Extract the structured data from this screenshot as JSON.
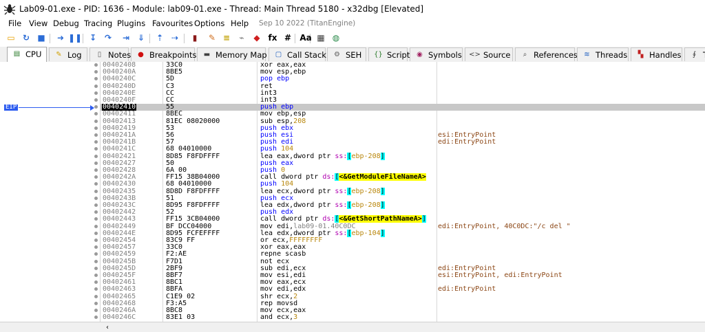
{
  "window": {
    "title": "Lab09-01.exe - PID: 1636 - Module: lab09-01.exe - Thread: Main Thread 5180 - x32dbg [Elevated]"
  },
  "menu": {
    "items": [
      "File",
      "View",
      "Debug",
      "Tracing",
      "Plugins",
      "Favourites",
      "Options",
      "Help"
    ],
    "build": "Sep 10 2022 (TitanEngine)"
  },
  "toolbar": {
    "buttons": [
      {
        "name": "open-icon",
        "glyph": "▭",
        "color": "#e8a000"
      },
      {
        "name": "restart-icon",
        "glyph": "↻",
        "color": "#2b6cd6"
      },
      {
        "name": "stop-icon",
        "glyph": "■",
        "color": "#2b6cd6"
      },
      {
        "name": "run-icon",
        "glyph": "➜",
        "color": "#2b6cd6"
      },
      {
        "name": "pause-icon",
        "glyph": "❚❚",
        "color": "#2b6cd6"
      },
      {
        "name": "step-into-icon",
        "glyph": "↧",
        "color": "#2b6cd6"
      },
      {
        "name": "step-over-icon",
        "glyph": "↷",
        "color": "#2b6cd6"
      },
      {
        "name": "trace-into-icon",
        "glyph": "⇥",
        "color": "#2b6cd6"
      },
      {
        "name": "trace-over-icon",
        "glyph": "⇓",
        "color": "#2b6cd6"
      },
      {
        "name": "execute-till-return-icon",
        "glyph": "⇡",
        "color": "#2b6cd6"
      },
      {
        "name": "run-to-user-code-icon",
        "glyph": "⇢",
        "color": "#2b6cd6"
      },
      {
        "name": "scylla-icon",
        "glyph": "▮",
        "color": "#8b1a1a"
      },
      {
        "name": "patch-icon",
        "glyph": "✎",
        "color": "#d07020"
      },
      {
        "name": "comment-icon",
        "glyph": "≡",
        "color": "#c0a000"
      },
      {
        "name": "label-icon",
        "glyph": "⌁",
        "color": "#7a7a7a"
      },
      {
        "name": "bookmark-icon",
        "glyph": "◆",
        "color": "#d02020"
      },
      {
        "name": "function-icon",
        "glyph": "fx",
        "color": "#000000"
      },
      {
        "name": "hash-icon",
        "glyph": "#",
        "color": "#000000"
      },
      {
        "name": "font-icon",
        "glyph": "Aa",
        "color": "#000000"
      },
      {
        "name": "calculator-icon",
        "glyph": "▦",
        "color": "#404040"
      },
      {
        "name": "globe-icon",
        "glyph": "◍",
        "color": "#2a8a4a"
      }
    ]
  },
  "tabs": [
    {
      "label": "CPU",
      "icon": "cpu-icon",
      "glyph": "▤",
      "color": "#2a7a2a",
      "active": true
    },
    {
      "label": "Log",
      "icon": "log-icon",
      "glyph": "✎",
      "color": "#d0a000",
      "active": false
    },
    {
      "label": "Notes",
      "icon": "notes-icon",
      "glyph": "▯",
      "color": "#606060",
      "active": false
    },
    {
      "label": "Breakpoints",
      "icon": "breakpoints-icon",
      "glyph": "●",
      "color": "#d01010",
      "active": false
    },
    {
      "label": "Memory Map",
      "icon": "memory-map-icon",
      "glyph": "▬",
      "color": "#404040",
      "active": false
    },
    {
      "label": "Call Stack",
      "icon": "call-stack-icon",
      "glyph": "▢",
      "color": "#2060c0",
      "active": false
    },
    {
      "label": "SEH",
      "icon": "seh-icon",
      "glyph": "⚙",
      "color": "#606060",
      "active": false
    },
    {
      "label": "Script",
      "icon": "script-icon",
      "glyph": "{}",
      "color": "#2a7a2a",
      "active": false
    },
    {
      "label": "Symbols",
      "icon": "symbols-icon",
      "glyph": "◉",
      "color": "#a02060",
      "active": false
    },
    {
      "label": "Source",
      "icon": "source-icon",
      "glyph": "<>",
      "color": "#404040",
      "active": false
    },
    {
      "label": "References",
      "icon": "references-icon",
      "glyph": "⌕",
      "color": "#404040",
      "active": false
    },
    {
      "label": "Threads",
      "icon": "threads-icon",
      "glyph": "≋",
      "color": "#2060c0",
      "active": false
    },
    {
      "label": "Handles",
      "icon": "handles-icon",
      "glyph": "▚",
      "color": "#c02020",
      "active": false
    },
    {
      "label": "Tr",
      "icon": "trace-icon",
      "glyph": "∮",
      "color": "#404040",
      "active": false
    }
  ],
  "eip_label": "EIP",
  "current_index": 6,
  "disassembly": [
    {
      "addr": "00402408",
      "bytes": "33C0",
      "asm": [
        {
          "t": "xor eax,eax"
        }
      ],
      "comment": ""
    },
    {
      "addr": "0040240A",
      "bytes": "8BE5",
      "asm": [
        {
          "t": "mov esp,ebp"
        }
      ],
      "comment": ""
    },
    {
      "addr": "0040240C",
      "bytes": "5D",
      "asm": [
        {
          "t": "pop ebp",
          "c": "ctl"
        }
      ],
      "comment": ""
    },
    {
      "addr": "0040240D",
      "bytes": "C3",
      "asm": [
        {
          "t": "ret",
          "c": "hlcyan"
        }
      ],
      "comment": ""
    },
    {
      "addr": "0040240E",
      "bytes": "CC",
      "asm": [
        {
          "t": "int3"
        }
      ],
      "comment": ""
    },
    {
      "addr": "0040240F",
      "bytes": "CC",
      "asm": [
        {
          "t": "int3"
        }
      ],
      "comment": ""
    },
    {
      "addr": "00402410",
      "bytes": "55",
      "asm": [
        {
          "t": "push ebp",
          "c": "ctl"
        }
      ],
      "comment": ""
    },
    {
      "addr": "00402411",
      "bytes": "8BEC",
      "asm": [
        {
          "t": "mov ebp,esp"
        }
      ],
      "comment": ""
    },
    {
      "addr": "00402413",
      "bytes": "81EC 08020000",
      "asm": [
        {
          "t": "sub esp,"
        },
        {
          "t": "208",
          "c": "num"
        }
      ],
      "comment": ""
    },
    {
      "addr": "00402419",
      "bytes": "53",
      "asm": [
        {
          "t": "push ebx",
          "c": "ctl"
        }
      ],
      "comment": ""
    },
    {
      "addr": "0040241A",
      "bytes": "56",
      "asm": [
        {
          "t": "push esi",
          "c": "ctl"
        }
      ],
      "comment": "esi:EntryPoint"
    },
    {
      "addr": "0040241B",
      "bytes": "57",
      "asm": [
        {
          "t": "push edi",
          "c": "ctl"
        }
      ],
      "comment": "edi:EntryPoint"
    },
    {
      "addr": "0040241C",
      "bytes": "68 04010000",
      "asm": [
        {
          "t": "push ",
          "c": "ctl"
        },
        {
          "t": "104",
          "c": "num"
        }
      ],
      "comment": ""
    },
    {
      "addr": "00402421",
      "bytes": "8D85 F8FDFFFF",
      "asm": [
        {
          "t": "lea eax,dword ptr "
        },
        {
          "t": "ss:",
          "c": "seg"
        },
        {
          "t": "[",
          "c": "brk"
        },
        {
          "t": "ebp-208",
          "c": "num"
        },
        {
          "t": "]",
          "c": "brk"
        }
      ],
      "comment": ""
    },
    {
      "addr": "00402427",
      "bytes": "50",
      "asm": [
        {
          "t": "push eax",
          "c": "ctl"
        }
      ],
      "comment": ""
    },
    {
      "addr": "00402428",
      "bytes": "6A 00",
      "asm": [
        {
          "t": "push ",
          "c": "ctl"
        },
        {
          "t": "0",
          "c": "num"
        }
      ],
      "comment": ""
    },
    {
      "addr": "0040242A",
      "bytes": "FF15 38B04000",
      "asm": [
        {
          "t": "call",
          "c": "hlcall"
        },
        {
          "t": " dword ptr "
        },
        {
          "t": "ds:",
          "c": "seg"
        },
        {
          "t": "[",
          "c": "brk"
        },
        {
          "t": "<&GetModuleFileNameA>",
          "c": "lbl"
        }
      ],
      "comment": ""
    },
    {
      "addr": "00402430",
      "bytes": "68 04010000",
      "asm": [
        {
          "t": "push ",
          "c": "ctl"
        },
        {
          "t": "104",
          "c": "num"
        }
      ],
      "comment": ""
    },
    {
      "addr": "00402435",
      "bytes": "8D8D F8FDFFFF",
      "asm": [
        {
          "t": "lea ecx,dword ptr "
        },
        {
          "t": "ss:",
          "c": "seg"
        },
        {
          "t": "[",
          "c": "brk"
        },
        {
          "t": "ebp-208",
          "c": "num"
        },
        {
          "t": "]",
          "c": "brk"
        }
      ],
      "comment": ""
    },
    {
      "addr": "0040243B",
      "bytes": "51",
      "asm": [
        {
          "t": "push ecx",
          "c": "ctl"
        }
      ],
      "comment": ""
    },
    {
      "addr": "0040243C",
      "bytes": "8D95 F8FDFFFF",
      "asm": [
        {
          "t": "lea edx,dword ptr "
        },
        {
          "t": "ss:",
          "c": "seg"
        },
        {
          "t": "[",
          "c": "brk"
        },
        {
          "t": "ebp-208",
          "c": "num"
        },
        {
          "t": "]",
          "c": "brk"
        }
      ],
      "comment": ""
    },
    {
      "addr": "00402442",
      "bytes": "52",
      "asm": [
        {
          "t": "push edx",
          "c": "ctl"
        }
      ],
      "comment": ""
    },
    {
      "addr": "00402443",
      "bytes": "FF15 3CB04000",
      "asm": [
        {
          "t": "call",
          "c": "hlcall"
        },
        {
          "t": " dword ptr "
        },
        {
          "t": "ds:",
          "c": "seg"
        },
        {
          "t": "[",
          "c": "brk"
        },
        {
          "t": "<&GetShortPathNameA>",
          "c": "lbl"
        },
        {
          "t": "]",
          "c": "brk"
        }
      ],
      "comment": ""
    },
    {
      "addr": "00402449",
      "bytes": "BF DCC04000",
      "asm": [
        {
          "t": "mov edi,"
        },
        {
          "t": "lab09-01.40C0DC",
          "c": "addrlbl"
        }
      ],
      "comment": "edi:EntryPoint, 40C0DC:\"/c del \""
    },
    {
      "addr": "0040244E",
      "bytes": "8D95 FCFEFFFF",
      "asm": [
        {
          "t": "lea edx,dword ptr "
        },
        {
          "t": "ss:",
          "c": "seg"
        },
        {
          "t": "[",
          "c": "brk"
        },
        {
          "t": "ebp-104",
          "c": "num"
        },
        {
          "t": "]",
          "c": "brk"
        }
      ],
      "comment": ""
    },
    {
      "addr": "00402454",
      "bytes": "83C9 FF",
      "asm": [
        {
          "t": "or ecx,"
        },
        {
          "t": "FFFFFFFF",
          "c": "num"
        }
      ],
      "comment": ""
    },
    {
      "addr": "00402457",
      "bytes": "33C0",
      "asm": [
        {
          "t": "xor eax,eax"
        }
      ],
      "comment": ""
    },
    {
      "addr": "00402459",
      "bytes": "F2:AE",
      "asm": [
        {
          "t": "repne scasb"
        }
      ],
      "comment": ""
    },
    {
      "addr": "0040245B",
      "bytes": "F7D1",
      "asm": [
        {
          "t": "not ecx"
        }
      ],
      "comment": ""
    },
    {
      "addr": "0040245D",
      "bytes": "2BF9",
      "asm": [
        {
          "t": "sub edi,ecx"
        }
      ],
      "comment": "edi:EntryPoint"
    },
    {
      "addr": "0040245F",
      "bytes": "8BF7",
      "asm": [
        {
          "t": "mov esi,edi"
        }
      ],
      "comment": "esi:EntryPoint, edi:EntryPoint"
    },
    {
      "addr": "00402461",
      "bytes": "8BC1",
      "asm": [
        {
          "t": "mov eax,ecx"
        }
      ],
      "comment": ""
    },
    {
      "addr": "00402463",
      "bytes": "8BFA",
      "asm": [
        {
          "t": "mov edi,edx"
        }
      ],
      "comment": "edi:EntryPoint"
    },
    {
      "addr": "00402465",
      "bytes": "C1E9 02",
      "asm": [
        {
          "t": "shr ecx,"
        },
        {
          "t": "2",
          "c": "num"
        }
      ],
      "comment": ""
    },
    {
      "addr": "00402468",
      "bytes": "F3:A5",
      "asm": [
        {
          "t": "rep movsd"
        }
      ],
      "comment": ""
    },
    {
      "addr": "0040246A",
      "bytes": "8BC8",
      "asm": [
        {
          "t": "mov ecx,eax"
        }
      ],
      "comment": ""
    },
    {
      "addr": "0040246C",
      "bytes": "83E1 03",
      "asm": [
        {
          "t": "and ecx,"
        },
        {
          "t": "3",
          "c": "num"
        }
      ],
      "comment": ""
    }
  ]
}
